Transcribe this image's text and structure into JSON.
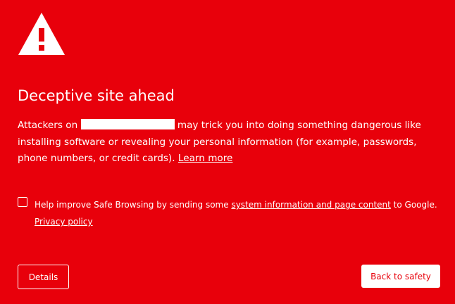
{
  "heading": {
    "icon": "warning-triangle-icon",
    "title": "Deceptive site ahead"
  },
  "message": {
    "prefix": "Attackers on",
    "suffix": "may trick you into doing something dangerous like installing software or revealing your personal information (for example, passwords, phone numbers, or credit cards).",
    "learn_more": "Learn more"
  },
  "optin": {
    "checked": false,
    "prefix": "Help improve Safe Browsing by sending some",
    "link": "system information and page content",
    "suffix": "to Google.",
    "privacy_link": "Privacy policy"
  },
  "buttons": {
    "details": "Details",
    "back_to_safety": "Back to safety"
  },
  "colors": {
    "background": "#e8000b",
    "foreground": "#ffffff"
  }
}
